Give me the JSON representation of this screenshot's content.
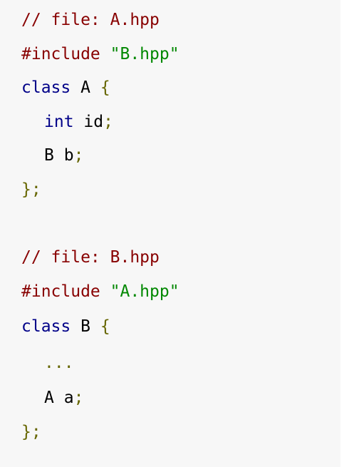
{
  "code": {
    "block_a": {
      "comment": "// file: A.hpp",
      "include_directive": "#include",
      "include_path": "\"B.hpp\"",
      "class_keyword": "class",
      "class_name": "A",
      "open_brace": "{",
      "member1_type": "int",
      "member1_name": "id",
      "member1_semicolon": ";",
      "member2_type": "B",
      "member2_name": "b",
      "member2_semicolon": ";",
      "close_brace": "}",
      "close_semicolon": ";"
    },
    "block_b": {
      "comment": "// file: B.hpp",
      "include_directive": "#include",
      "include_path": "\"A.hpp\"",
      "class_keyword": "class",
      "class_name": "B",
      "open_brace": "{",
      "ellipsis": "...",
      "member_type": "A",
      "member_name": "a",
      "member_semicolon": ";",
      "close_brace": "}",
      "close_semicolon": ";"
    }
  },
  "colors": {
    "background": "#f7f7f7",
    "comment": "#880000",
    "preprocessor": "#880000",
    "string": "#008800",
    "keyword": "#000088",
    "identifier": "#000000",
    "punctuation": "#666600"
  }
}
